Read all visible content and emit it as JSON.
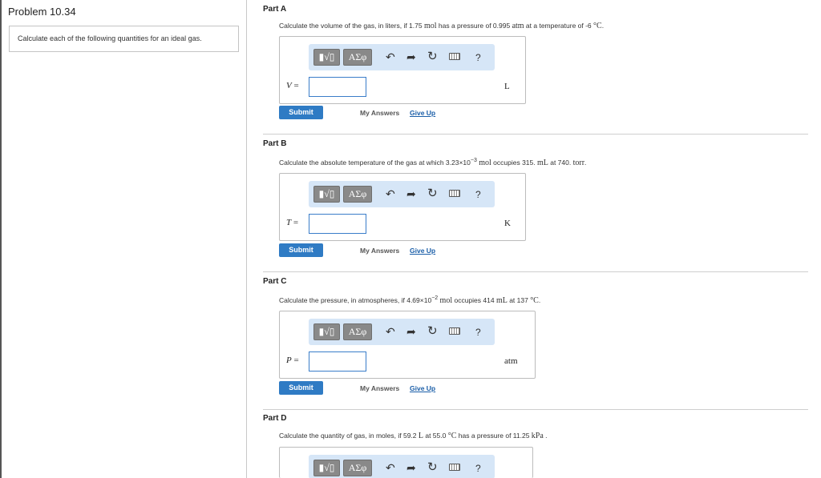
{
  "problem": {
    "title": "Problem 10.34",
    "intro": "Calculate each of the following quantities for an ideal gas."
  },
  "toolbar": {
    "template_label": "▮√▯",
    "greek_label": "ΑΣφ",
    "undo_icon": "undo-icon",
    "redo_icon": "redo-icon",
    "reset_icon": "reset-icon",
    "keyboard_icon": "keyboard-icon",
    "help_label": "?"
  },
  "actions": {
    "submit_label": "Submit",
    "my_answers_label": "My Answers",
    "give_up_label": "Give Up"
  },
  "parts": [
    {
      "header": "Part A",
      "q_pre": "Calculate the volume of the gas, in liters, if 1.75 ",
      "q_unit1": "mol",
      "q_mid": " has a pressure of 0.995 ",
      "q_unit2": "atm",
      "q_mid2": " at a temperature of -6 ",
      "q_unit3": "°C",
      "q_end": ".",
      "variable": "V",
      "equals": "=",
      "unit": "L"
    },
    {
      "header": "Part B",
      "q_pre": "Calculate the absolute temperature of the gas at which 3.23×10",
      "q_exp": "−3",
      "q_unit1": "mol",
      "q_mid": " occupies 315. ",
      "q_unit2": "mL",
      "q_mid2": " at 740. ",
      "q_unit3": "torr",
      "q_end": ".",
      "variable": "T",
      "equals": "=",
      "unit": "K"
    },
    {
      "header": "Part C",
      "q_pre": "Calculate the pressure, in atmospheres, if 4.69×10",
      "q_exp": "−2",
      "q_unit1": "mol",
      "q_mid": " occupies 414 ",
      "q_unit2": "mL",
      "q_mid2": " at 137 ",
      "q_unit3": "°C",
      "q_end": ".",
      "variable": "P",
      "equals": "=",
      "unit": "atm"
    },
    {
      "header": "Part D",
      "q_pre": "Calculate the quantity of gas, in moles, if 59.2 ",
      "q_unit1": "L",
      "q_mid": " at 55.0 ",
      "q_unit2": "°C",
      "q_mid2": " has a pressure of 11.25 ",
      "q_unit3": "kPa",
      "q_end": " ."
    }
  ]
}
